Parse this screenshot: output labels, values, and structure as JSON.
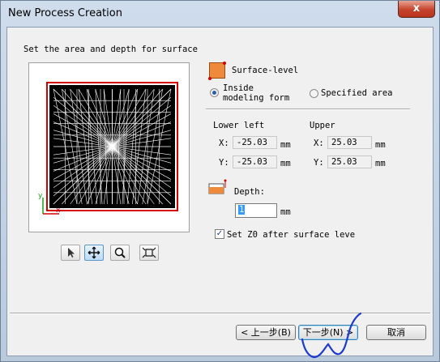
{
  "window": {
    "title": "New Process Creation",
    "close_label": "x"
  },
  "instruction": "Set the area and depth for surface",
  "surface_level": {
    "label": "Surface-level",
    "radio_inside_line1": "Inside",
    "radio_inside_line2": "modeling form",
    "radio_specified": "Specified area",
    "selected": "inside"
  },
  "lower_left": {
    "heading": "Lower left",
    "x_label": "X:",
    "x_value": "-25.03",
    "x_unit": "mm",
    "y_label": "Y:",
    "y_value": "-25.03",
    "y_unit": "mm"
  },
  "upper": {
    "heading": "Upper",
    "x_label": "X:",
    "x_value": "25.03",
    "x_unit": "mm",
    "y_label": "Y:",
    "y_value": "25.03",
    "y_unit": "mm"
  },
  "depth": {
    "label": "Depth:",
    "value": "1",
    "unit": "mm"
  },
  "set_z0": {
    "label": "Set Z0 after surface leve",
    "checked": true
  },
  "preview": {
    "axis_y": "y",
    "axis_x": "x"
  },
  "tools": [
    "pointer-tool",
    "pan-tool",
    "zoom-tool",
    "fit-tool"
  ],
  "buttons": {
    "back": "< 上一步(B)",
    "next": "下一步(N) >",
    "cancel": "取消"
  },
  "colors": {
    "selection_border": "#d40000",
    "icon_orange": "#ee8a3c",
    "axis_green": "#1aa01a",
    "axis_red": "#d40000"
  }
}
